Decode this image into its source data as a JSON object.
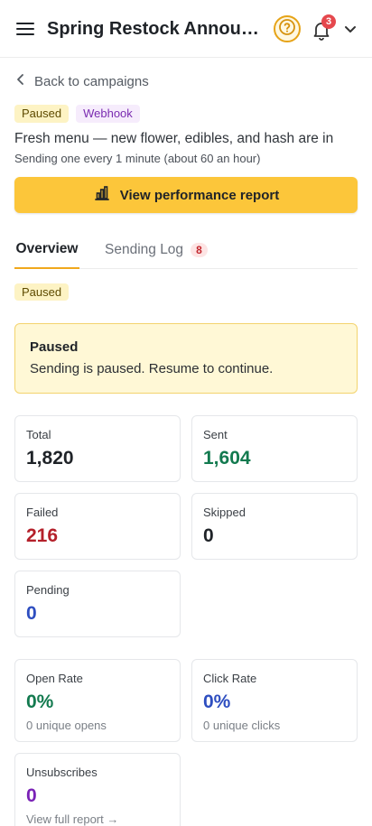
{
  "header": {
    "title": "Spring Restock Announcement",
    "notification_count": "3"
  },
  "nav": {
    "back_label": "Back to campaigns"
  },
  "campaign": {
    "status_chip": "Paused",
    "type_chip": "Webhook",
    "description": "Fresh menu — new flower, edibles, and hash are in",
    "rate_text": "Sending one every 1 minute (about 60 an hour)"
  },
  "actions": {
    "performance_label": "View performance report"
  },
  "tabs": [
    {
      "label": "Overview"
    },
    {
      "label": "Sending Log",
      "badge": "8"
    }
  ],
  "overview": {
    "status_chip": "Paused",
    "alert_title": "Paused",
    "alert_text": "Sending is paused. Resume to continue."
  },
  "stats": {
    "total": {
      "label": "Total",
      "value": "1,820"
    },
    "sent": {
      "label": "Sent",
      "value": "1,604"
    },
    "failed": {
      "label": "Failed",
      "value": "216"
    },
    "skipped": {
      "label": "Skipped",
      "value": "0"
    },
    "pending": {
      "label": "Pending",
      "value": "0"
    }
  },
  "engagement": {
    "open_rate": {
      "label": "Open Rate",
      "value": "0%",
      "sub": "0 unique opens"
    },
    "click_rate": {
      "label": "Click Rate",
      "value": "0%",
      "sub": "0 unique clicks"
    },
    "unsubscribes": {
      "label": "Unsubscribes",
      "value": "0",
      "sub": "View full report →"
    }
  },
  "colors": {
    "accent": "#fcc63a",
    "positive": "#137a4f",
    "negative": "#b4202a",
    "info": "#2e4ec0",
    "purple": "#7a22b6"
  },
  "icons": [
    "menu-icon",
    "help-icon",
    "bell-icon",
    "chevron-down-icon",
    "chevron-left-icon",
    "bar-chart-icon"
  ]
}
